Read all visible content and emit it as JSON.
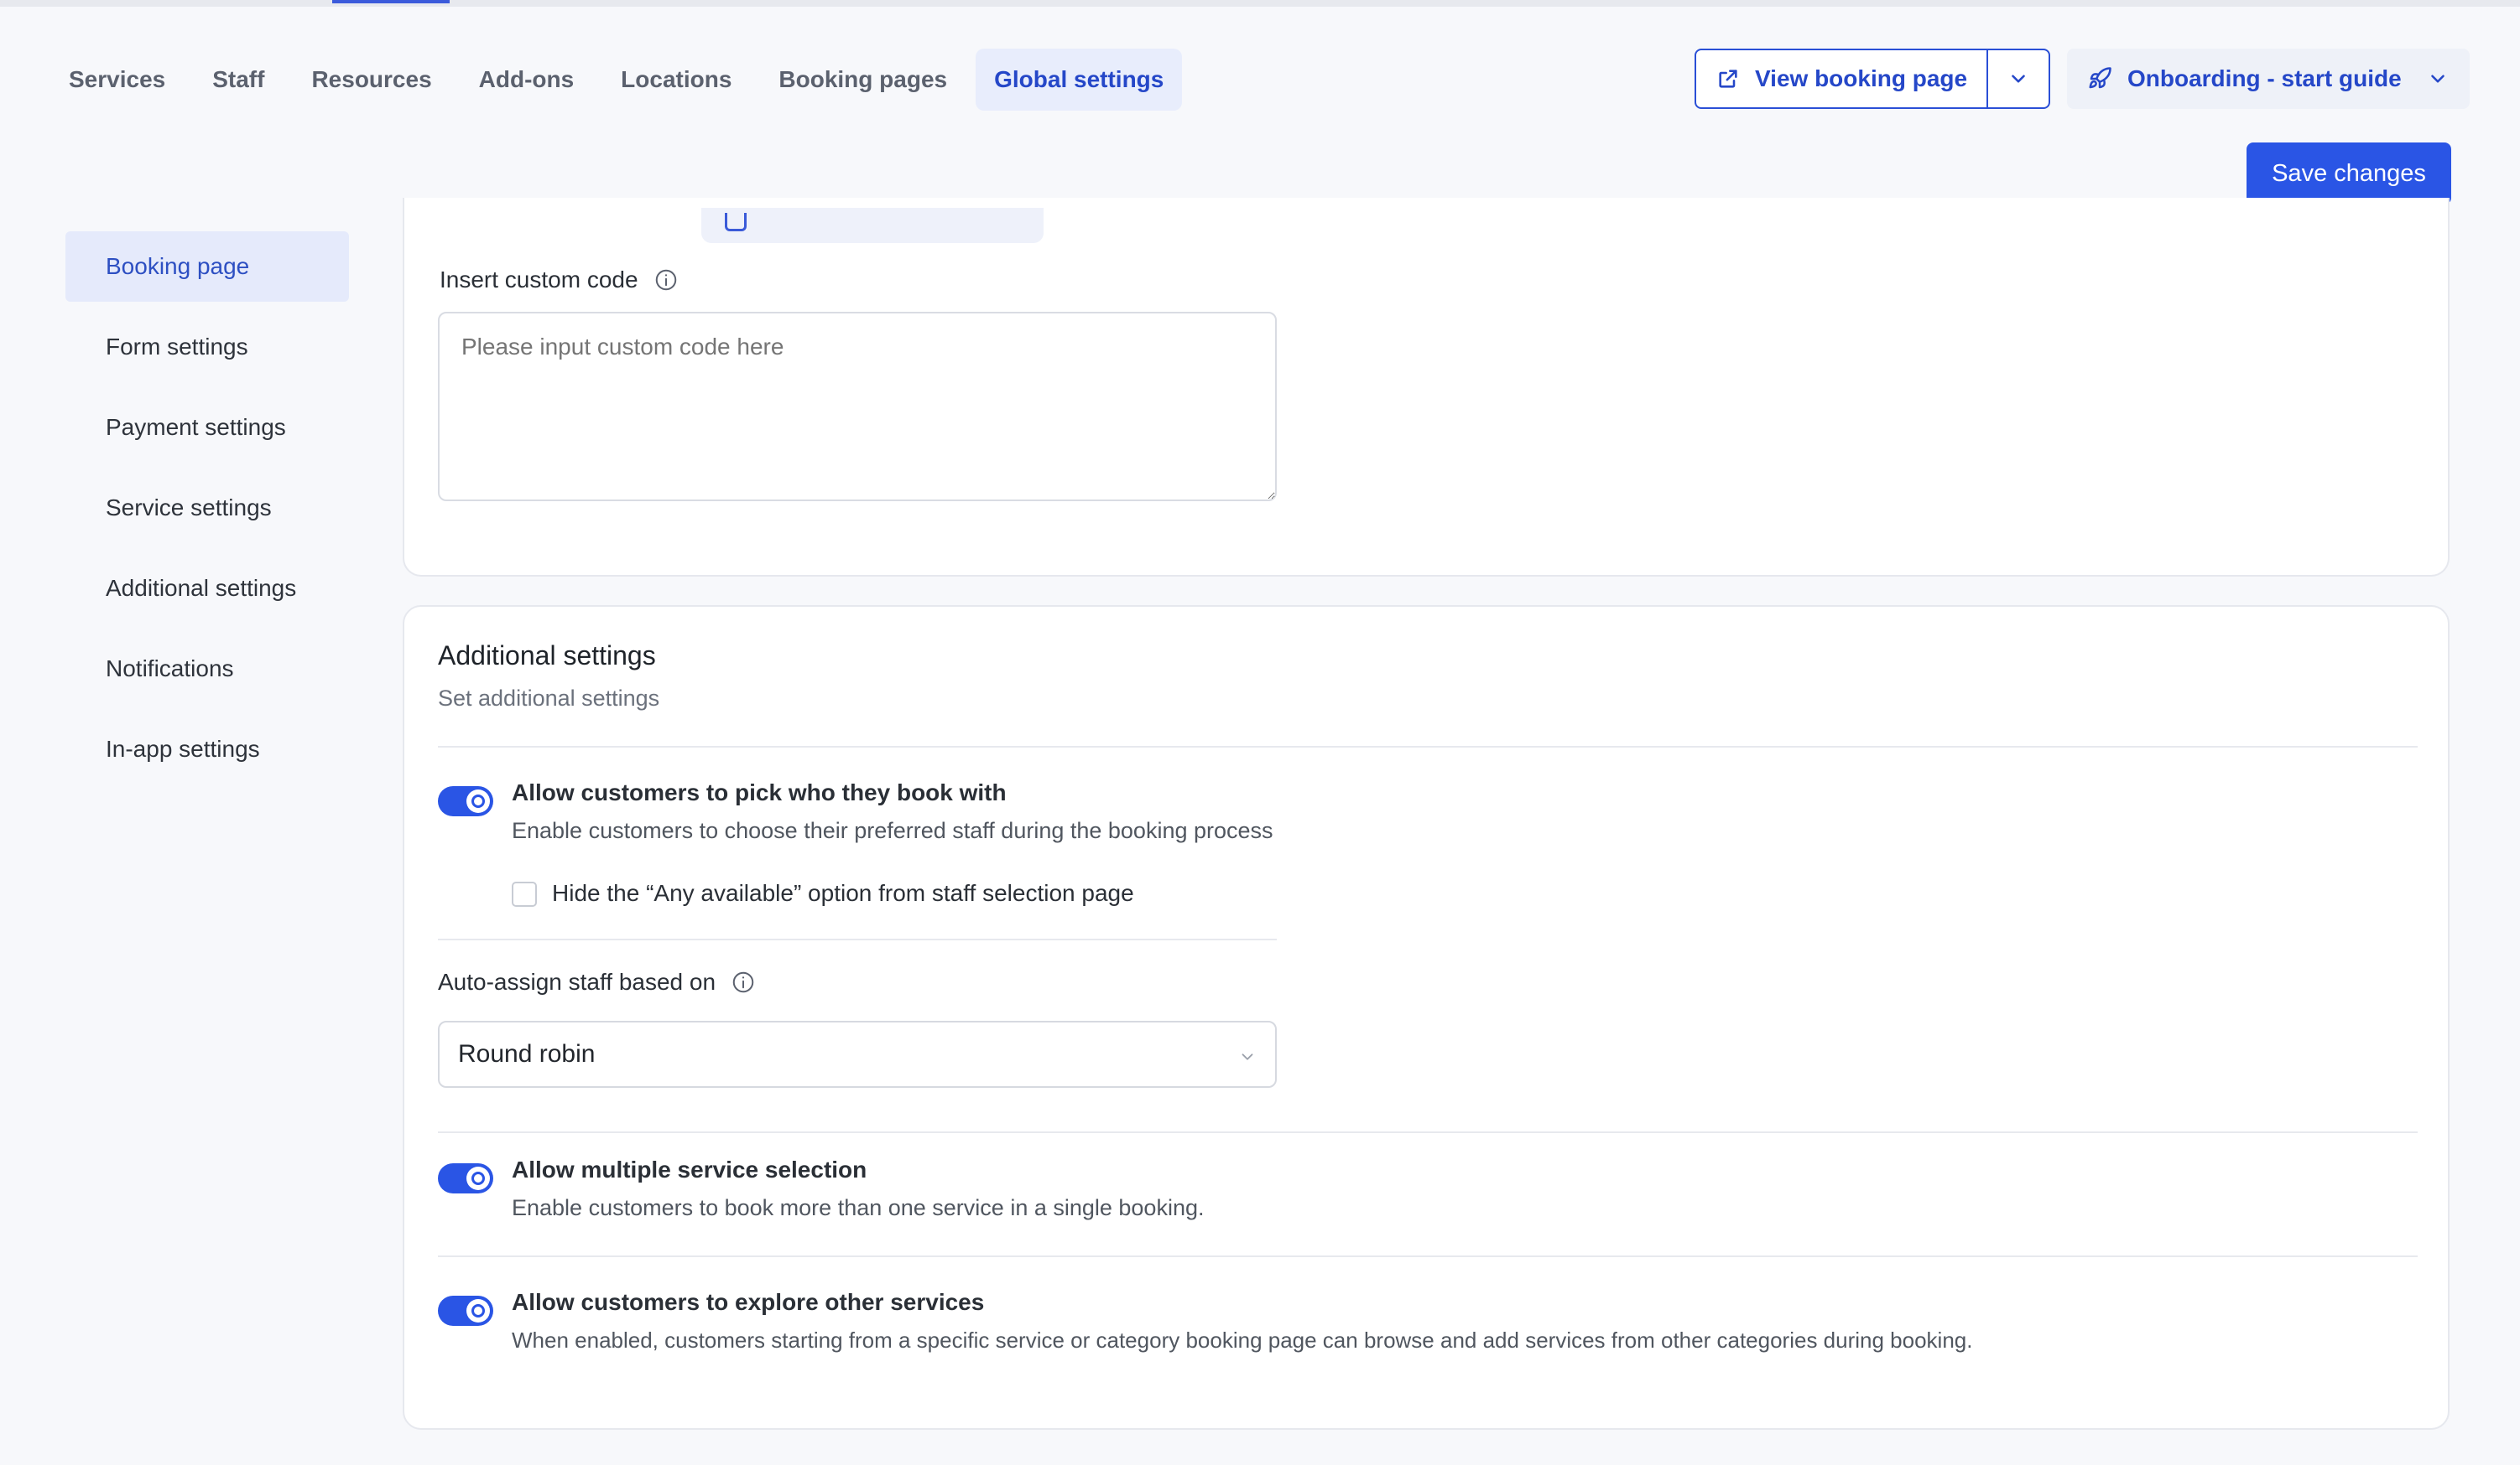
{
  "tabs": [
    {
      "label": "Services"
    },
    {
      "label": "Staff"
    },
    {
      "label": "Resources"
    },
    {
      "label": "Add-ons"
    },
    {
      "label": "Locations"
    },
    {
      "label": "Booking pages"
    },
    {
      "label": "Global settings",
      "active": true
    }
  ],
  "header": {
    "view_booking_label": "View booking page",
    "onboarding_label": "Onboarding - start guide",
    "save_label": "Save changes"
  },
  "sidebar": {
    "items": [
      {
        "label": "Booking page",
        "active": true
      },
      {
        "label": "Form settings"
      },
      {
        "label": "Payment settings"
      },
      {
        "label": "Service settings"
      },
      {
        "label": "Additional settings"
      },
      {
        "label": "Notifications"
      },
      {
        "label": "In-app settings"
      }
    ]
  },
  "custom_code": {
    "label": "Insert custom code",
    "placeholder": "Please input custom code here",
    "value": ""
  },
  "additional": {
    "title": "Additional settings",
    "subtitle": "Set additional settings",
    "pick_staff": {
      "title": "Allow customers to pick who they book with",
      "desc": "Enable customers to choose their preferred staff during the booking process",
      "enabled": true
    },
    "hide_any_available": {
      "label": "Hide the “Any available” option from staff selection page",
      "checked": false
    },
    "auto_assign": {
      "label": "Auto-assign staff based on",
      "selected": "Round robin"
    },
    "multi_service": {
      "title": "Allow multiple service selection",
      "desc": "Enable customers to book more than one service in a single booking.",
      "enabled": true
    },
    "explore_services": {
      "title": "Allow customers to explore other services",
      "desc": "When enabled, customers starting from a specific service or category booking page can browse and add services from other categories during booking.",
      "enabled": true
    }
  },
  "colors": {
    "accent": "#2a55e5",
    "accent_text": "#2547c8",
    "active_bg": "#e5eafb"
  }
}
